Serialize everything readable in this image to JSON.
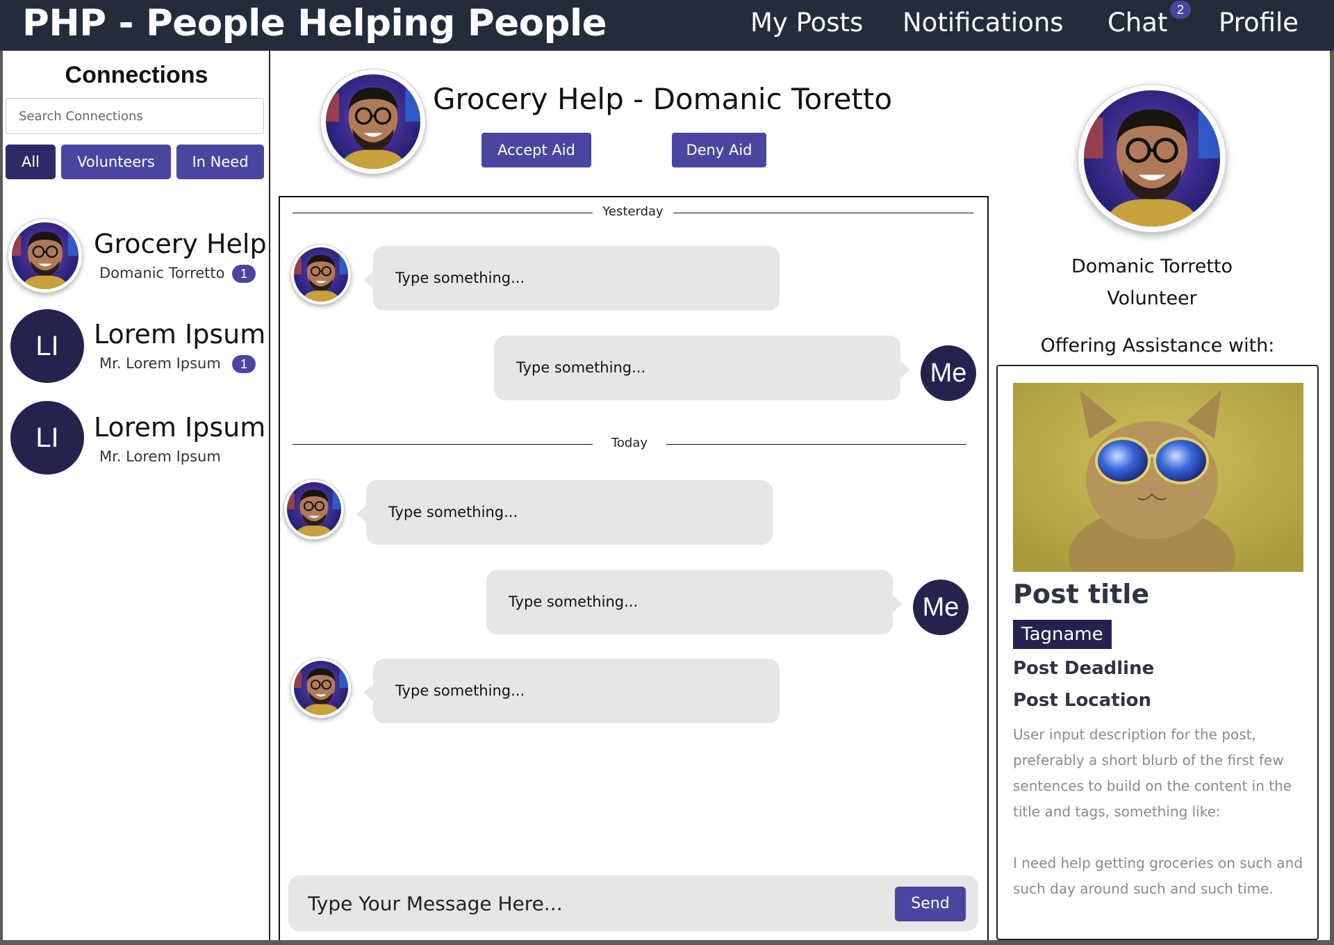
{
  "app": {
    "title": "PHP - People Helping People"
  },
  "nav": {
    "my_posts": "My Posts",
    "notifications": "Notifications",
    "chat": "Chat",
    "chat_badge": "2",
    "profile": "Profile"
  },
  "sidebar": {
    "title": "Connections",
    "search_placeholder": "Search Connections",
    "filters": [
      "All",
      "Volunteers",
      "In Need"
    ],
    "items": [
      {
        "name": "Grocery Help",
        "sub": "Domanic Torretto",
        "badge": "1",
        "avatar": "photo"
      },
      {
        "name": "Lorem Ipsum",
        "sub": "Mr. Lorem Ipsum",
        "badge": "1",
        "initials": "LI"
      },
      {
        "name": "Lorem Ipsum",
        "sub": "Mr. Lorem Ipsum",
        "initials": "LI"
      }
    ]
  },
  "chat": {
    "title": "Grocery Help - Domanic Toretto",
    "accept_label": "Accept Aid",
    "deny_label": "Deny Aid",
    "dividers": [
      "Yesterday",
      "Today"
    ],
    "messages": [
      {
        "from": "them",
        "text": "Type something..."
      },
      {
        "from": "me",
        "text": "Type something...",
        "avatar_label": "Me"
      },
      {
        "from": "them",
        "text": "Type something..."
      },
      {
        "from": "me",
        "text": "Type something...",
        "avatar_label": "Me"
      },
      {
        "from": "them",
        "text": "Type something..."
      }
    ],
    "composer_placeholder": "Type Your Message Here...",
    "send_label": "Send"
  },
  "profile": {
    "name": "Domanic Torretto",
    "role": "Volunteer",
    "offering_label": "Offering Assistance with:",
    "post": {
      "title": "Post title",
      "tag": "Tagname",
      "deadline": "Post Deadline",
      "location": "Post Location",
      "description": "User input description for the post, preferably a short blurb of the first few sentences to build on the content in the title and tags, something like:\n\nI need help getting groceries on such and such day around such and such time."
    }
  },
  "colors": {
    "topbar": "#242c3c",
    "accent": "#4b45a0",
    "dark_accent": "#252250",
    "bubble": "#e6e6e6"
  }
}
